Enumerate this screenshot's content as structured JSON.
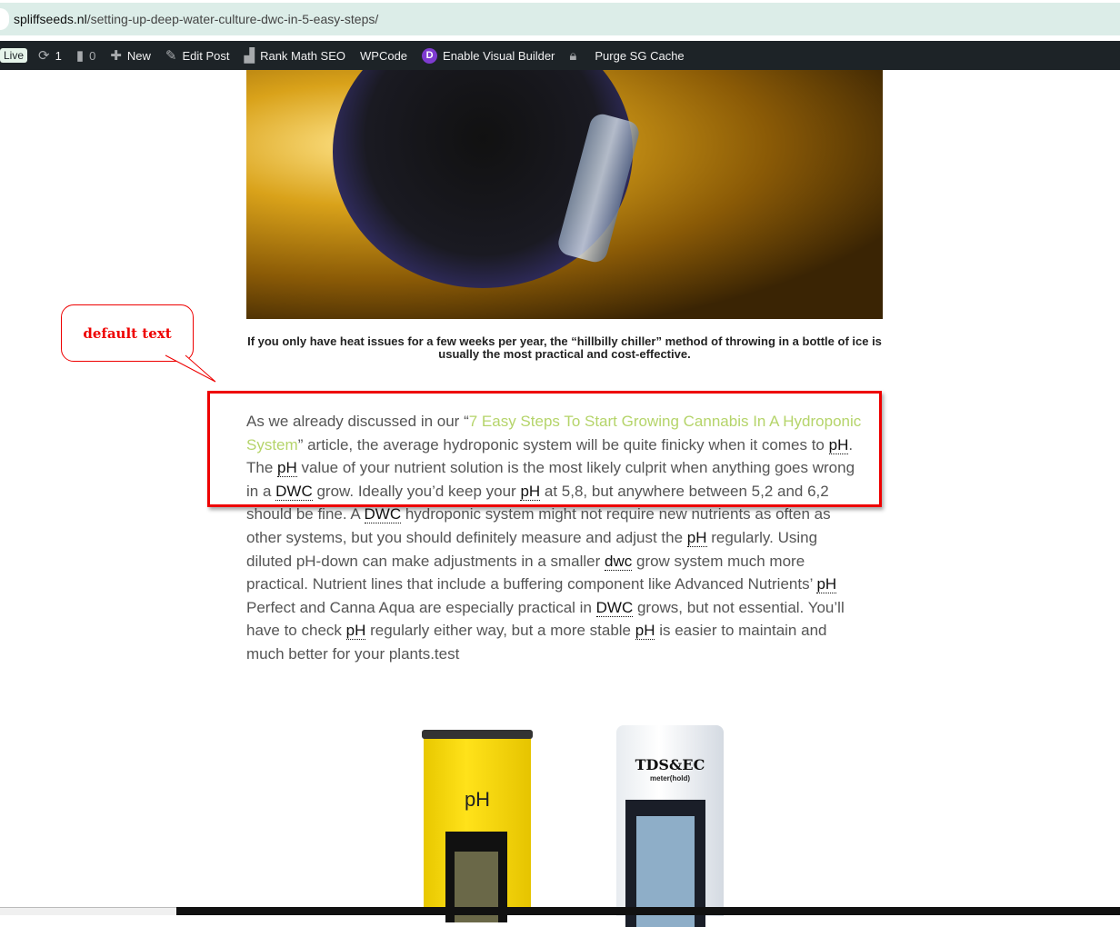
{
  "browser": {
    "url_host": "spliffseeds.nl",
    "url_path": "/setting-up-deep-water-culture-dwc-in-5-easy-steps/"
  },
  "admin_bar": {
    "live": "Live",
    "updates": "1",
    "comments": "0",
    "new": "New",
    "edit_post": "Edit Post",
    "rank_math": "Rank Math SEO",
    "wpcode": "WPCode",
    "divi_logo": "D",
    "visual_builder": "Enable Visual Builder",
    "purge": "Purge SG Cache"
  },
  "article": {
    "caption": "If you only have heat issues for a few weeks per year, the “hillbilly chiller” method of throwing in a bottle of ice is usually the most practical and cost-effective.",
    "paragraph_lines": [
      [
        {
          "t": "As we already discussed in our “"
        },
        {
          "t": "7 Easy Steps To Start Growing Cannabis In A Hydroponic",
          "k": "lk"
        }
      ],
      [
        {
          "t": "System",
          "k": "lk"
        },
        {
          "t": "” article, the average hydroponic system will be quite finicky when it comes to "
        },
        {
          "t": "pH",
          "k": "gl"
        },
        {
          "t": "."
        }
      ],
      [
        {
          "t": "The "
        },
        {
          "t": "pH",
          "k": "gl"
        },
        {
          "t": " value of your nutrient solution is the most likely culprit when anything goes wrong"
        }
      ],
      [
        {
          "t": "in a "
        },
        {
          "t": "DWC",
          "k": "gl"
        },
        {
          "t": " grow. Ideally you’d keep your "
        },
        {
          "t": "pH",
          "k": "gl"
        },
        {
          "t": " at 5,8, but anywhere between 5,2 and 6,2"
        }
      ],
      [
        {
          "t": "should be fine. A "
        },
        {
          "t": "DWC",
          "k": "gl"
        },
        {
          "t": " hydroponic system might not require new nutrients as often as"
        }
      ],
      [
        {
          "t": "other systems, but you should definitely measure and adjust the "
        },
        {
          "t": "pH",
          "k": "gl"
        },
        {
          "t": " regularly. Using"
        }
      ],
      [
        {
          "t": "diluted pH-down can make adjustments in a smaller "
        },
        {
          "t": "dwc",
          "k": "gl"
        },
        {
          "t": " grow system much more"
        }
      ],
      [
        {
          "t": "practical. Nutrient lines that include a buffering component like Advanced Nutrients’ "
        },
        {
          "t": "pH",
          "k": "gl"
        }
      ],
      [
        {
          "t": "Perfect and Canna Aqua are especially practical in "
        },
        {
          "t": "DWC",
          "k": "gl"
        },
        {
          "t": " grows, but not essential. You’ll"
        }
      ],
      [
        {
          "t": "have to check "
        },
        {
          "t": "pH",
          "k": "gl"
        },
        {
          "t": " regularly either way, but a more stable "
        },
        {
          "t": "pH",
          "k": "gl"
        },
        {
          "t": " is easier to maintain and"
        }
      ],
      [
        {
          "t": "much better for your plants.test"
        }
      ]
    ],
    "meter_ph_label": "pH",
    "meter_tds_label": "TDS&EC",
    "meter_tds_sub": "meter(hold)"
  },
  "annotation": {
    "callout": "default text",
    "color": "#e00000"
  }
}
